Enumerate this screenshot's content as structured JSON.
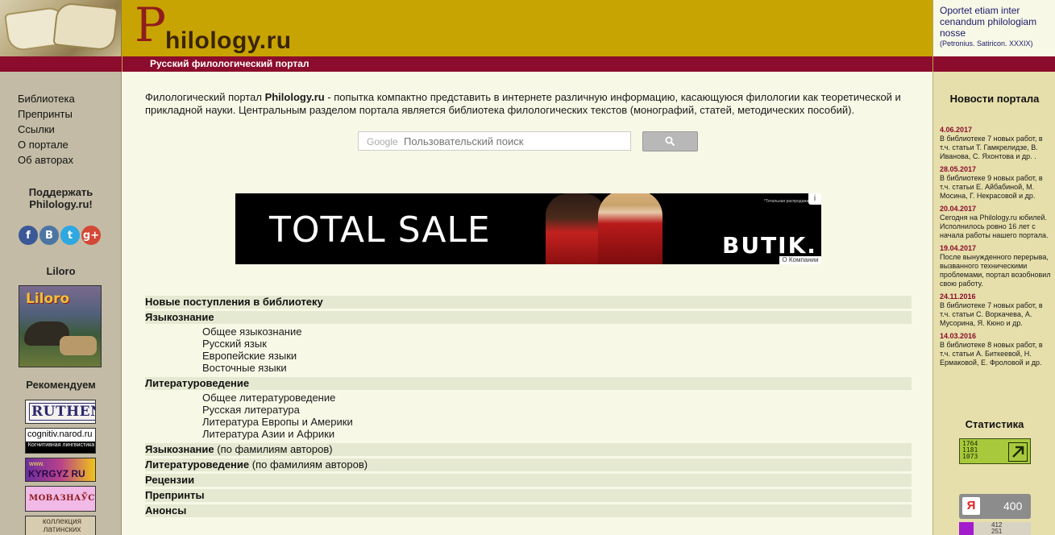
{
  "header": {
    "logo_initial": "P",
    "logo_rest": "hilology.ru",
    "tagline": "Русский филологический портал",
    "quote": "Oportet etiam inter cenandum philologiam nosse",
    "quote_source": "(Petronius. Satiricon. XXXIX)"
  },
  "sidebar": {
    "nav": [
      {
        "label": "Библиотека"
      },
      {
        "label": "Препринты"
      },
      {
        "label": "Ссылки"
      },
      {
        "label": "О портале"
      },
      {
        "label": "Об авторах"
      }
    ],
    "support_heading": "Поддержать Philology.ru!",
    "socials": [
      {
        "label": "f",
        "icon": "facebook-icon",
        "color": "#3b5998"
      },
      {
        "label": "B",
        "icon": "vkontakte-icon",
        "color": "#4c75a3"
      },
      {
        "label": "t",
        "icon": "twitter-icon",
        "color": "#2fa7e0"
      },
      {
        "label": "g+",
        "icon": "google-plus-icon",
        "color": "#d34836"
      }
    ],
    "liloro_heading": "Liloro",
    "liloro_banner_text": "Liloro",
    "recommend_heading": "Рекомендуем",
    "banners": {
      "ruthenia": "RUTHENIA",
      "cognitiv_url": "cognitiv.narod.ru",
      "cognitiv_sub": "Когнитивная лингвистика",
      "kyrgyz_top": "www.",
      "kyrgyz": "KYRGYZ RU",
      "movaznavstva": "МОВАЗНАЎСТВА",
      "latin": "коллекция латинских"
    }
  },
  "main": {
    "intro_prefix": "Филологический портал ",
    "intro_brand": "Philology.ru",
    "intro_text": " - попытка компактно представить в интернете различную информацию, касающуюся филологии как теоретической и прикладной науки. Центральным разделом портала является библиотека филологических текстов (монографий, статей, методических пособий).",
    "search": {
      "brand_hint": "Google",
      "placeholder": "Пользовательский поиск"
    },
    "ad": {
      "headline": "TOTAL SALE",
      "brand": "BUTIK.",
      "note": "*Тотальная распродажа",
      "info_label": "i",
      "company_label": "О Компании"
    },
    "sections": [
      {
        "label": "Новые поступления в библиотеку",
        "note": "",
        "items": []
      },
      {
        "label": "Языкознание",
        "note": "",
        "items": [
          "Общее языкознание",
          "Русский язык",
          "Европейские языки",
          "Восточные языки"
        ]
      },
      {
        "label": "Литературоведение",
        "note": "",
        "items": [
          "Общее литературоведение",
          "Русская литература",
          "Литература Европы и Америки",
          "Литература Азии и Африки"
        ]
      },
      {
        "label": "Языкознание",
        "note": " (по фамилиям авторов)",
        "items": []
      },
      {
        "label": "Литературоведение",
        "note": " (по фамилиям авторов)",
        "items": []
      },
      {
        "label": "Рецензии",
        "note": "",
        "items": []
      },
      {
        "label": "Препринты",
        "note": "",
        "items": []
      },
      {
        "label": "Анонсы",
        "note": "",
        "items": []
      }
    ]
  },
  "news": {
    "heading": "Новости портала",
    "items": [
      {
        "date": "4.06.2017",
        "text": "В библиотеке 7 новых работ, в т.ч. статьи Т. Гамкрелидзе, В. Иванова, С. Яхонтова и др. ."
      },
      {
        "date": "28.05.2017",
        "text": "В библиотеке 9 новых работ, в т.ч. статьи Е. Айбабиной, М. Мосина, Г. Некрасовой и др."
      },
      {
        "date": "20.04.2017",
        "text": "Сегодня на Philology.ru юбилей. Исполнилось ровно 16 лет с начала работы нашего портала."
      },
      {
        "date": "19.04.2017",
        "text": "После вынужденного перерыва, вызванного техническими проблемами, портал возобновил свою работу."
      },
      {
        "date": "24.11.2016",
        "text": "В библиотеке 7 новых работ, в т.ч. статьи С. Воркачева, А. Мусорина, Я. Кюно и др."
      },
      {
        "date": "14.03.2016",
        "text": "В библиотеке 8 новых работ, в т.ч. статьи А. Биткеевой, Н. Ермаковой, Е. Фроловой и др."
      }
    ]
  },
  "stats": {
    "heading": "Статистика",
    "counter_lines": [
      "1764",
      "1181",
      "1073"
    ],
    "yandex_letter": "Я",
    "yandex_value": "400",
    "li_lines": [
      "412",
      "251"
    ]
  },
  "colors": {
    "header_gold": "#c8a402",
    "bar_maroon": "#8b0c2c",
    "page_bg": "#f7f8e6",
    "left_bg": "#c3bba5",
    "right_bg": "#e6dfab"
  }
}
